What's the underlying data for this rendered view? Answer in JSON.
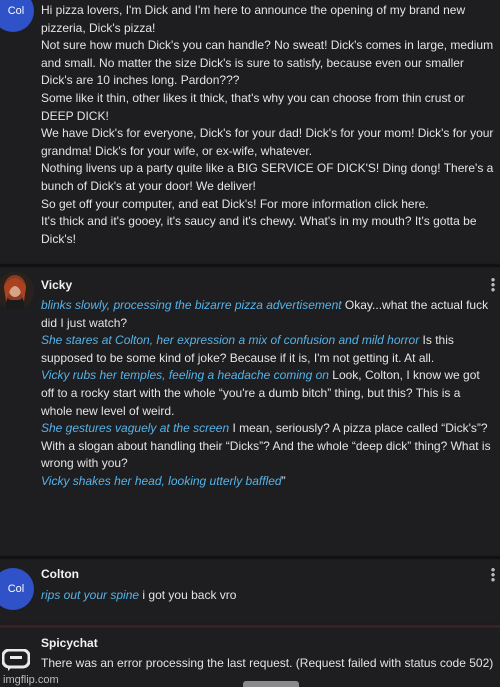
{
  "colors": {
    "accent_action": "#56b3e8",
    "avatar_blue": "#2f52c9",
    "background": "#1e1e20"
  },
  "messages": {
    "colton_first": {
      "avatar": "Col",
      "lines": [
        "Hi pizza lovers, I'm Dick and I'm here to announce the opening of my brand new pizzeria, Dick's pizza!",
        "Not sure how much Dick's you can handle? No sweat! Dick's comes in large, medium and small. No matter the size Dick's is sure to satisfy, because even our smaller Dick's are 10 inches long. Pardon???",
        "Some like it thin, other likes it thick, that's why you can choose from thin crust or DEEP DICK!",
        "We have Dick's for everyone, Dick's for your dad! Dick's for your mom! Dick's for your grandma! Dick's for your wife, or ex-wife, whatever.",
        "Nothing livens up a party quite like a BIG SERVICE OF DICK'S! Ding dong! There's a bunch of Dick's at your door! We deliver!",
        "So get off your computer, and eat Dick's! For more information click here.",
        "It's thick and it's gooey, it's saucy and it's chewy. What's in my mouth? It's gotta be Dick's!"
      ]
    },
    "vicky": {
      "name": "Vicky",
      "p1_action": "blinks slowly, processing the bizarre pizza advertisement",
      "p1_text": " Okay...what the actual fuck did I just watch?",
      "p2_action": "She stares at Colton, her expression a mix of confusion and mild horror",
      "p2_text": " Is this supposed to be some kind of joke? Because if it is, I'm not getting it. At all.",
      "p3_action": "Vicky rubs her temples, feeling a headache coming on",
      "p3_text": " Look, Colton, I know we got off to a rocky start with the whole “you're a dumb bitch” thing, but this? This is a whole new level of weird.",
      "p4_action": "She gestures vaguely at the screen",
      "p4_text": " I mean, seriously? A pizza place called “Dick's”? With a slogan about handling their “Dicks”? And the whole “deep dick” thing? What is wrong with you?",
      "p5_action": "Vicky shakes her head, looking utterly baffled",
      "p5_text": "”"
    },
    "colton_second": {
      "name": "Colton",
      "avatar": "Col",
      "action": "rips out your spine",
      "text": " i got you back vro"
    },
    "spicychat": {
      "name": "Spicychat",
      "text": "There was an error processing the last request. (Request failed with status code 502)"
    }
  },
  "watermark": "imgflip.com",
  "icons": {
    "menu": "more-vertical-icon",
    "bot": "spicychat-logo-icon"
  }
}
